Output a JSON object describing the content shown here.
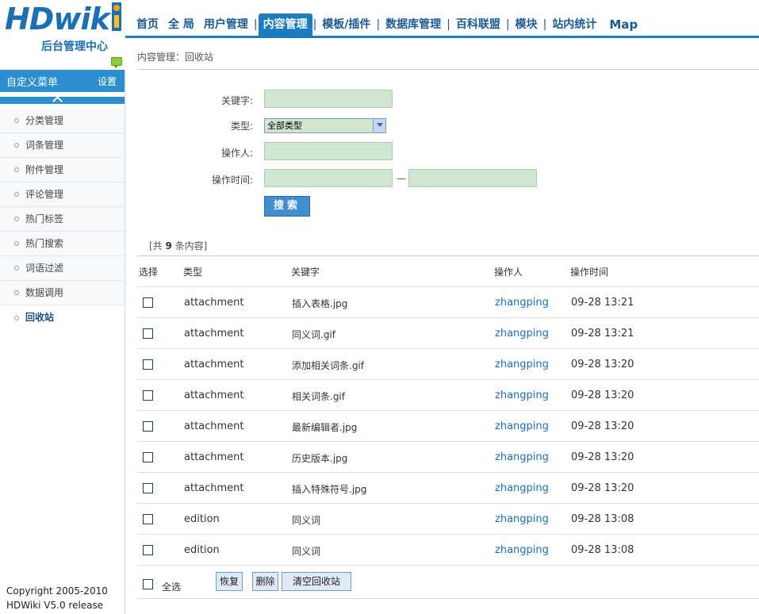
{
  "brand": {
    "logo_text": "HDwik",
    "subtitle": "后台管理中心"
  },
  "topnav": {
    "items": [
      "首页",
      "全 局",
      "用户管理",
      "内容管理",
      "模板/插件",
      "数据库管理",
      "百科联盟",
      "模块",
      "站内统计"
    ],
    "active": "内容管理",
    "separator": "|",
    "map_label": "Map"
  },
  "sidebar": {
    "header_title": "自定义菜单",
    "header_settings": "设置",
    "items": [
      "分类管理",
      "词条管理",
      "附件管理",
      "评论管理",
      "热门标签",
      "热门搜索",
      "词语过滤",
      "数据调用",
      "回收站"
    ],
    "active": "回收站",
    "copyright_line1": "Copyright 2005-2010",
    "copyright_line2": "HDWiki V5.0 release"
  },
  "main": {
    "breadcrumb": "内容管理：回收站",
    "form": {
      "keyword_label": "关键字:",
      "keyword_value": "",
      "type_label": "类型:",
      "type_selected": "全部类型",
      "operator_label": "操作人:",
      "operator_value": "",
      "time_label": "操作时间:",
      "time_start": "",
      "time_end": "",
      "time_separator": "—",
      "search_button": "搜索"
    },
    "count": {
      "prefix": "[共 ",
      "number": "9",
      "suffix": " 条内容]"
    },
    "table": {
      "headers": [
        "选择",
        "类型",
        "关键字",
        "操作人",
        "操作时间"
      ],
      "rows": [
        {
          "type": "attachment",
          "keyword": "插入表格.jpg",
          "operator": "zhangping",
          "time": "09-28 13:21"
        },
        {
          "type": "attachment",
          "keyword": "同义词.gif",
          "operator": "zhangping",
          "time": "09-28 13:21"
        },
        {
          "type": "attachment",
          "keyword": "添加相关词条.gif",
          "operator": "zhangping",
          "time": "09-28 13:20"
        },
        {
          "type": "attachment",
          "keyword": "相关词条.gif",
          "operator": "zhangping",
          "time": "09-28 13:20"
        },
        {
          "type": "attachment",
          "keyword": "最新编辑者.jpg",
          "operator": "zhangping",
          "time": "09-28 13:20"
        },
        {
          "type": "attachment",
          "keyword": "历史版本.jpg",
          "operator": "zhangping",
          "time": "09-28 13:20"
        },
        {
          "type": "attachment",
          "keyword": "插入特殊符号.jpg",
          "operator": "zhangping",
          "time": "09-28 13:20"
        },
        {
          "type": "edition",
          "keyword": "同义词",
          "operator": "zhangping",
          "time": "09-28 13:08"
        },
        {
          "type": "edition",
          "keyword": "同义词",
          "operator": "zhangping",
          "time": "09-28 13:08"
        }
      ]
    },
    "footer": {
      "select_all_label": "全选",
      "restore_button": "恢复",
      "delete_button": "删除",
      "empty_button": "清空回收站"
    }
  },
  "colors": {
    "accent": "#1a7dc0",
    "link": "#1a6fb5",
    "input_bg": "#cfe7d1"
  }
}
